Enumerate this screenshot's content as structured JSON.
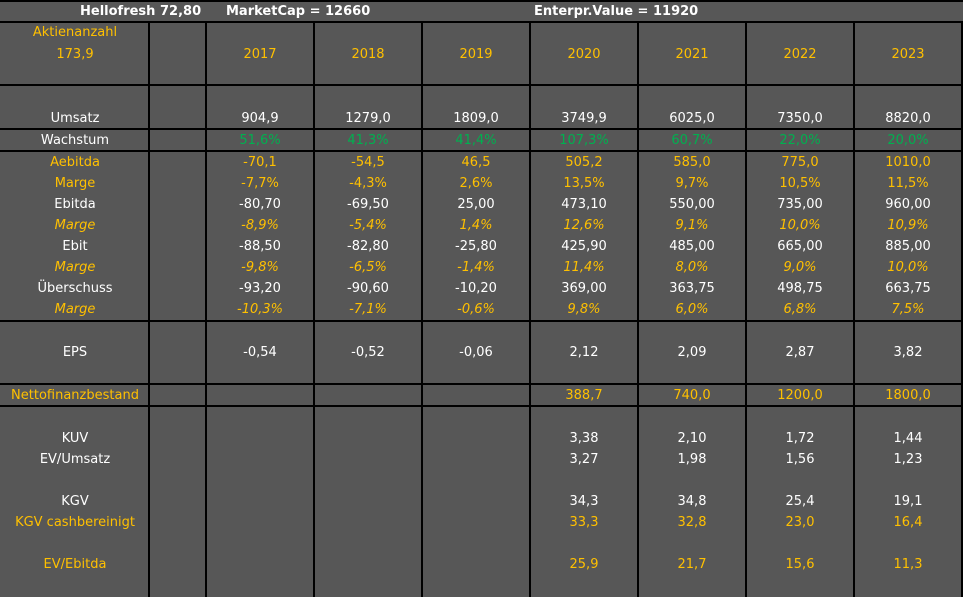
{
  "header": {
    "company": "Hellofresh",
    "price": "72,80",
    "marketcap": "MarketCap = 12660",
    "ev": "Enterpr.Value = 11920"
  },
  "shares": {
    "label": "Aktienanzahl",
    "value": "173,9"
  },
  "years": [
    "2017",
    "2018",
    "2019",
    "2020",
    "2021",
    "2022",
    "2023"
  ],
  "rows": [
    {
      "label": "Umsatz",
      "style": "white",
      "values": [
        "904,9",
        "1279,0",
        "1809,0",
        "3749,9",
        "6025,0",
        "7350,0",
        "8820,0"
      ]
    },
    {
      "label": "Wachstum",
      "style": "green",
      "values": [
        "51,6%",
        "41,3%",
        "41,4%",
        "107,3%",
        "60,7%",
        "22,0%",
        "20,0%"
      ]
    },
    {
      "label": "Aebitda",
      "style": "gold",
      "values": [
        "-70,1",
        "-54,5",
        "46,5",
        "505,2",
        "585,0",
        "775,0",
        "1010,0"
      ]
    },
    {
      "label": "Marge",
      "style": "gold",
      "values": [
        "-7,7%",
        "-4,3%",
        "2,6%",
        "13,5%",
        "9,7%",
        "10,5%",
        "11,5%"
      ]
    },
    {
      "label": "Ebitda",
      "style": "white",
      "values": [
        "-80,70",
        "-69,50",
        "25,00",
        "473,10",
        "550,00",
        "735,00",
        "960,00"
      ]
    },
    {
      "label": "Marge",
      "style": "gold-italic",
      "values": [
        "-8,9%",
        "-5,4%",
        "1,4%",
        "12,6%",
        "9,1%",
        "10,0%",
        "10,9%"
      ]
    },
    {
      "label": "Ebit",
      "style": "white",
      "values": [
        "-88,50",
        "-82,80",
        "-25,80",
        "425,90",
        "485,00",
        "665,00",
        "885,00"
      ]
    },
    {
      "label": "Marge",
      "style": "gold-italic",
      "values": [
        "-9,8%",
        "-6,5%",
        "-1,4%",
        "11,4%",
        "8,0%",
        "9,0%",
        "10,0%"
      ]
    },
    {
      "label": "Überschuss",
      "style": "white",
      "values": [
        "-93,20",
        "-90,60",
        "-10,20",
        "369,00",
        "363,75",
        "498,75",
        "663,75"
      ]
    },
    {
      "label": "Marge",
      "style": "gold-italic",
      "values": [
        "-10,3%",
        "-7,1%",
        "-0,6%",
        "9,8%",
        "6,0%",
        "6,8%",
        "7,5%"
      ]
    },
    {
      "label": "EPS",
      "style": "white",
      "values": [
        "-0,54",
        "-0,52",
        "-0,06",
        "2,12",
        "2,09",
        "2,87",
        "3,82"
      ]
    },
    {
      "label": "Nettofinanzbestand",
      "style": "gold",
      "values": [
        "",
        "",
        "",
        "388,7",
        "740,0",
        "1200,0",
        "1800,0"
      ]
    },
    {
      "label": "KUV",
      "style": "white",
      "values": [
        "",
        "",
        "",
        "3,38",
        "2,10",
        "1,72",
        "1,44"
      ]
    },
    {
      "label": "EV/Umsatz",
      "style": "white",
      "values": [
        "",
        "",
        "",
        "3,27",
        "1,98",
        "1,56",
        "1,23"
      ]
    },
    {
      "label": "KGV",
      "style": "white",
      "values": [
        "",
        "",
        "",
        "34,3",
        "34,8",
        "25,4",
        "19,1"
      ]
    },
    {
      "label": "KGV cashbereinigt",
      "style": "gold",
      "values": [
        "",
        "",
        "",
        "33,3",
        "32,8",
        "23,0",
        "16,4"
      ]
    },
    {
      "label": "EV/Ebitda",
      "style": "gold",
      "values": [
        "",
        "",
        "",
        "25,9",
        "21,7",
        "15,6",
        "11,3"
      ]
    }
  ]
}
